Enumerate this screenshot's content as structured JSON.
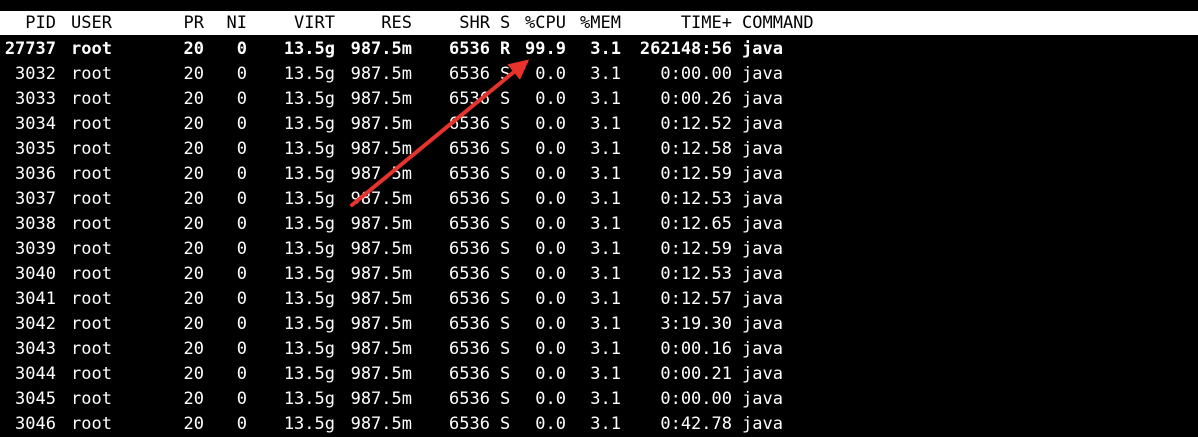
{
  "header": {
    "pid": "PID",
    "user": "USER",
    "pr": "PR",
    "ni": "NI",
    "virt": "VIRT",
    "res": "RES",
    "shr": "SHR",
    "s": "S",
    "cpu": "%CPU",
    "mem": "%MEM",
    "time": "TIME+",
    "command": "COMMAND"
  },
  "processes": [
    {
      "pid": "27737",
      "user": "root",
      "pr": "20",
      "ni": "0",
      "virt": "13.5g",
      "res": "987.5m",
      "shr": "6536",
      "s": "R",
      "cpu": "99.9",
      "mem": "3.1",
      "time": "262148:56",
      "command": "java"
    },
    {
      "pid": "3032",
      "user": "root",
      "pr": "20",
      "ni": "0",
      "virt": "13.5g",
      "res": "987.5m",
      "shr": "6536",
      "s": "S",
      "cpu": "0.0",
      "mem": "3.1",
      "time": "0:00.00",
      "command": "java"
    },
    {
      "pid": "3033",
      "user": "root",
      "pr": "20",
      "ni": "0",
      "virt": "13.5g",
      "res": "987.5m",
      "shr": "6536",
      "s": "S",
      "cpu": "0.0",
      "mem": "3.1",
      "time": "0:00.26",
      "command": "java"
    },
    {
      "pid": "3034",
      "user": "root",
      "pr": "20",
      "ni": "0",
      "virt": "13.5g",
      "res": "987.5m",
      "shr": "6536",
      "s": "S",
      "cpu": "0.0",
      "mem": "3.1",
      "time": "0:12.52",
      "command": "java"
    },
    {
      "pid": "3035",
      "user": "root",
      "pr": "20",
      "ni": "0",
      "virt": "13.5g",
      "res": "987.5m",
      "shr": "6536",
      "s": "S",
      "cpu": "0.0",
      "mem": "3.1",
      "time": "0:12.58",
      "command": "java"
    },
    {
      "pid": "3036",
      "user": "root",
      "pr": "20",
      "ni": "0",
      "virt": "13.5g",
      "res": "987.5m",
      "shr": "6536",
      "s": "S",
      "cpu": "0.0",
      "mem": "3.1",
      "time": "0:12.59",
      "command": "java"
    },
    {
      "pid": "3037",
      "user": "root",
      "pr": "20",
      "ni": "0",
      "virt": "13.5g",
      "res": "987.5m",
      "shr": "6536",
      "s": "S",
      "cpu": "0.0",
      "mem": "3.1",
      "time": "0:12.53",
      "command": "java"
    },
    {
      "pid": "3038",
      "user": "root",
      "pr": "20",
      "ni": "0",
      "virt": "13.5g",
      "res": "987.5m",
      "shr": "6536",
      "s": "S",
      "cpu": "0.0",
      "mem": "3.1",
      "time": "0:12.65",
      "command": "java"
    },
    {
      "pid": "3039",
      "user": "root",
      "pr": "20",
      "ni": "0",
      "virt": "13.5g",
      "res": "987.5m",
      "shr": "6536",
      "s": "S",
      "cpu": "0.0",
      "mem": "3.1",
      "time": "0:12.59",
      "command": "java"
    },
    {
      "pid": "3040",
      "user": "root",
      "pr": "20",
      "ni": "0",
      "virt": "13.5g",
      "res": "987.5m",
      "shr": "6536",
      "s": "S",
      "cpu": "0.0",
      "mem": "3.1",
      "time": "0:12.53",
      "command": "java"
    },
    {
      "pid": "3041",
      "user": "root",
      "pr": "20",
      "ni": "0",
      "virt": "13.5g",
      "res": "987.5m",
      "shr": "6536",
      "s": "S",
      "cpu": "0.0",
      "mem": "3.1",
      "time": "0:12.57",
      "command": "java"
    },
    {
      "pid": "3042",
      "user": "root",
      "pr": "20",
      "ni": "0",
      "virt": "13.5g",
      "res": "987.5m",
      "shr": "6536",
      "s": "S",
      "cpu": "0.0",
      "mem": "3.1",
      "time": "3:19.30",
      "command": "java"
    },
    {
      "pid": "3043",
      "user": "root",
      "pr": "20",
      "ni": "0",
      "virt": "13.5g",
      "res": "987.5m",
      "shr": "6536",
      "s": "S",
      "cpu": "0.0",
      "mem": "3.1",
      "time": "0:00.16",
      "command": "java"
    },
    {
      "pid": "3044",
      "user": "root",
      "pr": "20",
      "ni": "0",
      "virt": "13.5g",
      "res": "987.5m",
      "shr": "6536",
      "s": "S",
      "cpu": "0.0",
      "mem": "3.1",
      "time": "0:00.21",
      "command": "java"
    },
    {
      "pid": "3045",
      "user": "root",
      "pr": "20",
      "ni": "0",
      "virt": "13.5g",
      "res": "987.5m",
      "shr": "6536",
      "s": "S",
      "cpu": "0.0",
      "mem": "3.1",
      "time": "0:00.00",
      "command": "java"
    },
    {
      "pid": "3046",
      "user": "root",
      "pr": "20",
      "ni": "0",
      "virt": "13.5g",
      "res": "987.5m",
      "shr": "6536",
      "s": "S",
      "cpu": "0.0",
      "mem": "3.1",
      "time": "0:42.78",
      "command": "java"
    }
  ],
  "highlighted_row": 0,
  "colors": {
    "background": "#000000",
    "text": "#ffffff",
    "header_background": "#ffffff",
    "header_text": "#000000",
    "annotation_arrow": "#e8322c"
  },
  "annotation": {
    "icon": "red-arrow-icon"
  }
}
